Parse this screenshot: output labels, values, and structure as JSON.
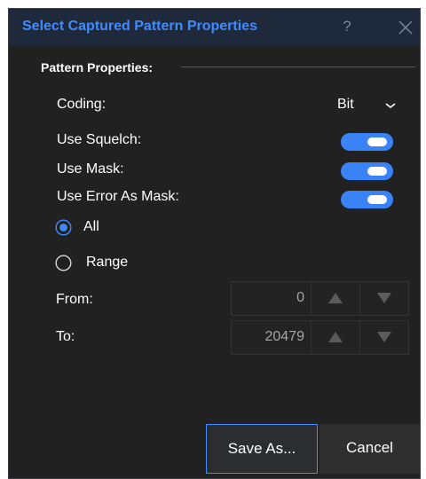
{
  "dialog": {
    "title": "Select Captured Pattern Properties",
    "help_label": "?",
    "section_title": "Pattern Properties:"
  },
  "coding": {
    "label": "Coding:",
    "value": "Bit"
  },
  "toggles": [
    {
      "label": "Use Squelch:",
      "on": true
    },
    {
      "label": "Use Mask:",
      "on": true
    },
    {
      "label": "Use Error As Mask:",
      "on": true
    }
  ],
  "range_mode": {
    "options": [
      "All",
      "Range"
    ],
    "selected": "All"
  },
  "from": {
    "label": "From:",
    "value": "0"
  },
  "to": {
    "label": "To:",
    "value": "20479"
  },
  "buttons": {
    "save_as": "Save As...",
    "cancel": "Cancel"
  },
  "colors": {
    "accent": "#3f8bff",
    "toggle_on": "#3a82f7",
    "background": "#212121",
    "titlebar": "#1e2a3c"
  }
}
